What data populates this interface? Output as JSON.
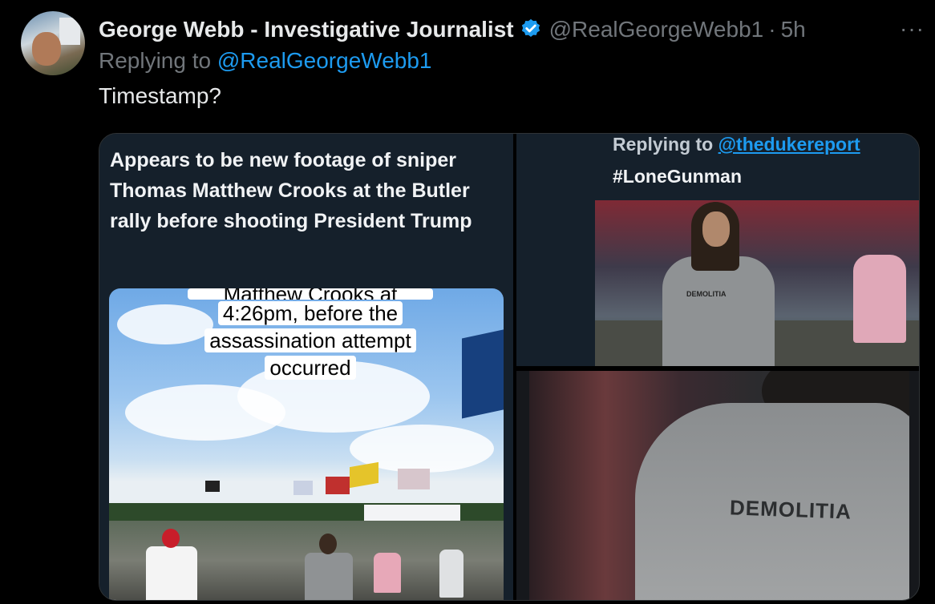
{
  "author": {
    "name": "George Webb - Investigative Journalist",
    "handle": "@RealGeorgeWebb1",
    "separator": "·",
    "time": "5h",
    "more": "···"
  },
  "reply": {
    "prefix": "Replying to",
    "mention": "@RealGeorgeWebb1"
  },
  "tweet_text": "Timestamp?",
  "media": {
    "left_caption": "Appears to be new footage of sniper Thomas Matthew Crooks at the Butler rally before shooting President Trump",
    "video_overlay_top": "Matthew Crooks at",
    "video_overlay": [
      "4:26pm, before the",
      "assassination attempt",
      "occurred"
    ],
    "right_reply_prefix": "Replying to",
    "right_reply_mention": "@thedukereport",
    "right_hashtag": "#LoneGunman",
    "shirt_text_small": "DEMOLITIA",
    "shirt_text_large": "DEMOLITIA"
  },
  "colors": {
    "background": "#000000",
    "accent": "#1d9bf0",
    "muted": "#71767b",
    "text": "#e7e9ea",
    "embed_bg": "#15202b"
  },
  "icons": {
    "verified": "verified-badge-icon",
    "more": "more-icon"
  }
}
